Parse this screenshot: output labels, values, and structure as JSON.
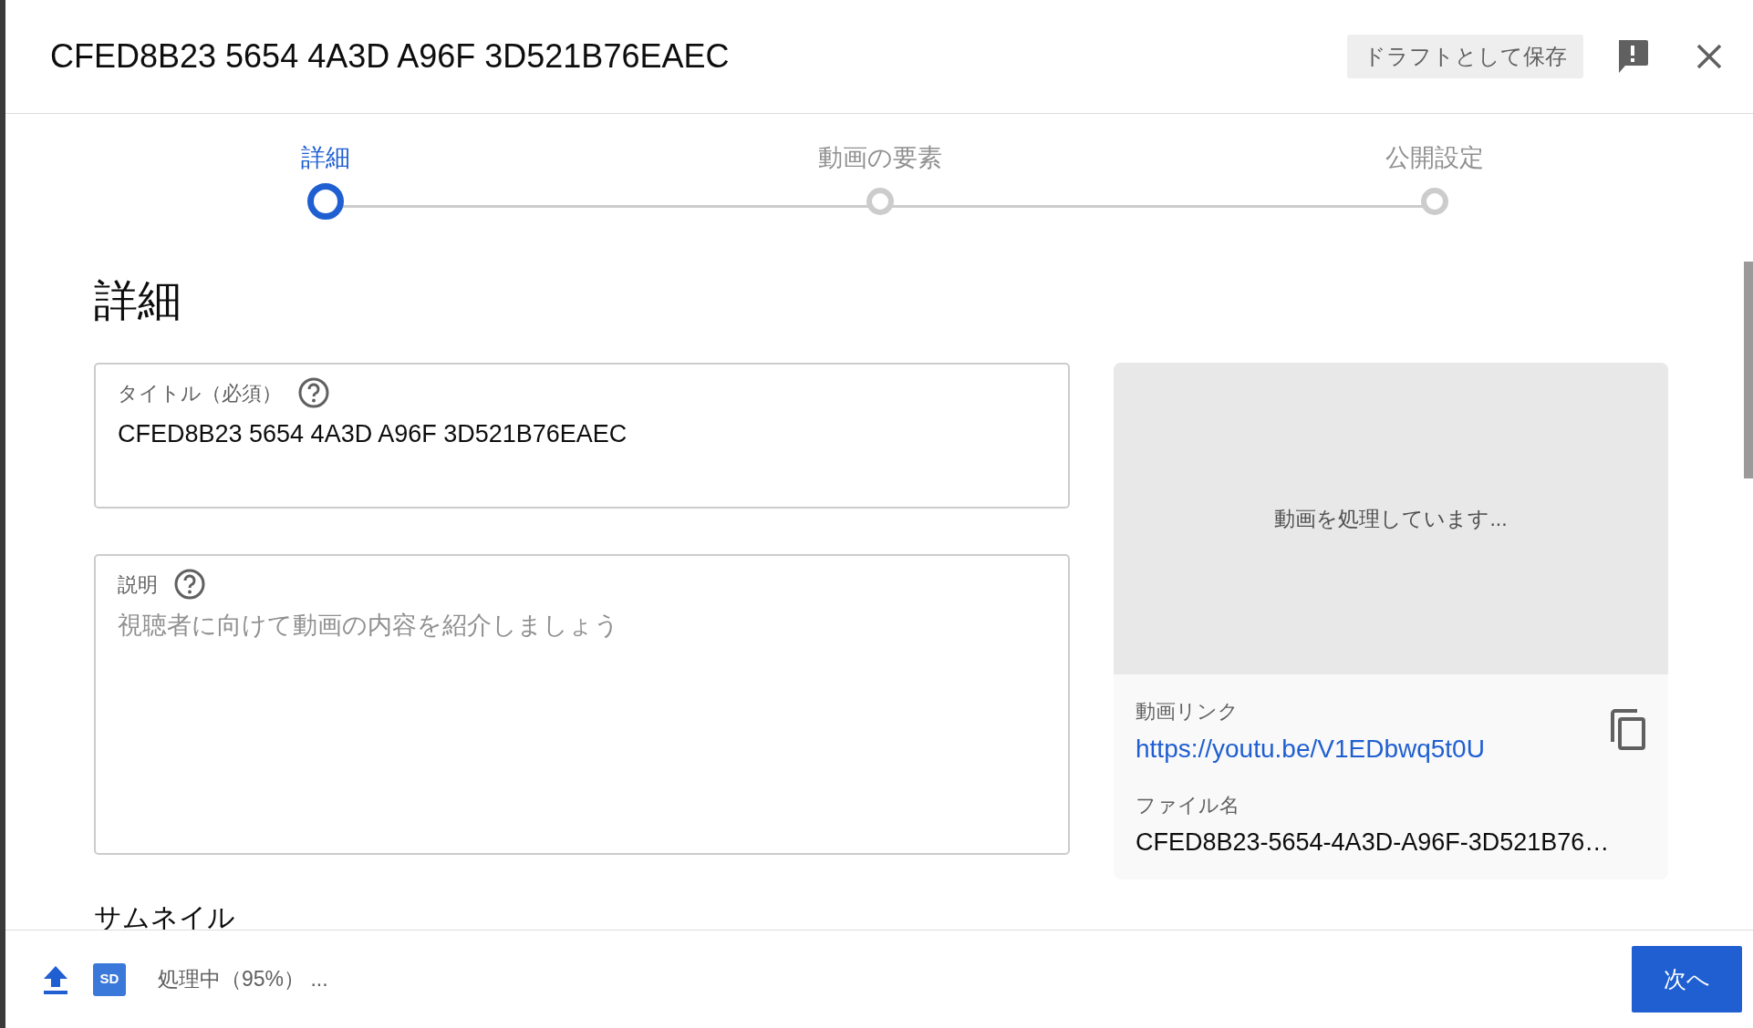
{
  "dialog": {
    "title": "CFED8B23 5654 4A3D A96F 3D521B76EAEC",
    "save_draft_button": "ドラフトとして保存"
  },
  "steps": [
    {
      "label": "詳細",
      "selected": true
    },
    {
      "label": "動画の要素",
      "selected": false
    },
    {
      "label": "公開設定",
      "selected": false
    }
  ],
  "section_heading": "詳細",
  "title_field": {
    "label": "タイトル（必須）",
    "value": "CFED8B23 5654 4A3D A96F 3D521B76EAEC"
  },
  "description_field": {
    "label": "説明",
    "placeholder": "視聴者に向けて動画の内容を紹介しましょう"
  },
  "preview": {
    "status": "動画を処理しています...",
    "link_label": "動画リンク",
    "link": "https://youtu.be/V1EDbwq5t0U",
    "filename_label": "ファイル名",
    "filename": "CFED8B23-5654-4A3D-A96F-3D521B76…"
  },
  "thumbnail_heading": "サムネイル",
  "footer": {
    "quality_badge": "SD",
    "status": "処理中（95%） ...",
    "next_button": "次へ"
  }
}
